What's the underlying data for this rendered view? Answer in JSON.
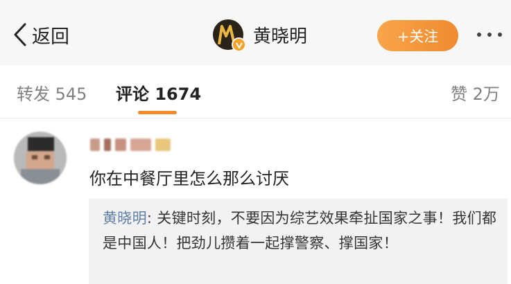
{
  "nav": {
    "back_label": "返回",
    "profile_name": "黄晓明",
    "follow_label": "+关注",
    "more_icon": "more-icon"
  },
  "tabs": {
    "repost": "转发 545",
    "comment": "评论 1674",
    "like": "赞 2万"
  },
  "comment": {
    "text": "你在中餐厅里怎么那么讨厌",
    "reply": {
      "author": "黄晓明",
      "separator": ": ",
      "text": "关键时刻，不要因为综艺效果牵扯国家之事！我们都是中国人！把劲儿攒着一起撑警察、撑国家！"
    }
  },
  "colors": {
    "accent": "#f58b2c",
    "follow_button": "#f6a045",
    "reply_author": "#5d7ea6"
  }
}
